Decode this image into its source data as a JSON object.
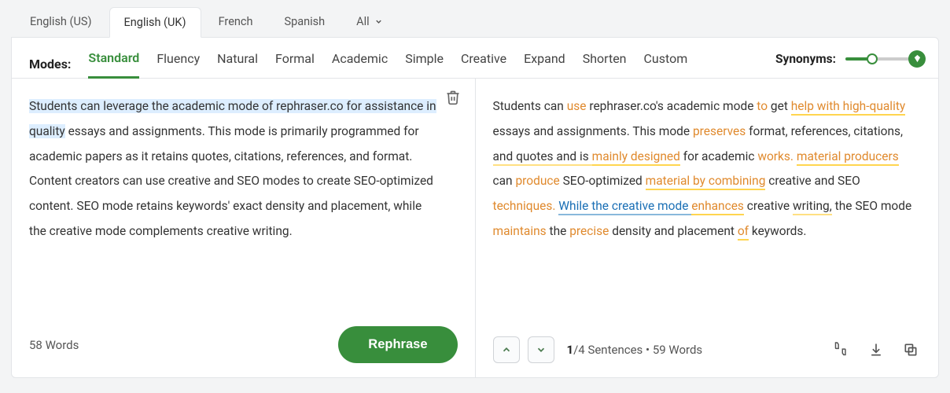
{
  "langs": {
    "en_us": "English (US)",
    "en_uk": "English (UK)",
    "fr": "French",
    "es": "Spanish",
    "all": "All"
  },
  "modes": {
    "label": "Modes:",
    "standard": "Standard",
    "fluency": "Fluency",
    "natural": "Natural",
    "formal": "Formal",
    "academic": "Academic",
    "simple": "Simple",
    "creative": "Creative",
    "expand": "Expand",
    "shorten": "Shorten",
    "custom": "Custom"
  },
  "synonyms_label": "Synonyms:",
  "input": {
    "seg1": "Students can leverage the academic mode of rephraser.co for assistance in quality",
    "seg2": " essays and assignments. This mode is primarily programmed for academic papers as it retains quotes, citations, references, and format.",
    "para2": "Content creators can use creative and SEO modes to create SEO-optimized content. SEO mode retains keywords' exact density and placement, while the creative mode complements creative writing.",
    "word_count": "58 Words",
    "button": "Rephrase"
  },
  "output": {
    "s1": "Students can ",
    "s2": "use",
    "s3": " rephraser.co's academic mode ",
    "s4": "to",
    "s5": " get ",
    "s6": "help with high-quality",
    "s7": " essays and assignments. This mode ",
    "s8": "preserves",
    "s9": " format, references, citations, ",
    "s10": "and quotes and is ",
    "s11": "mainly designed",
    "s12": " for academic ",
    "s13": "works.",
    "s14": "material producers",
    "s15": " can ",
    "s16": "produce",
    "s17": " SEO-optimized ",
    "s18": "material by combining",
    "s19": " creative and SEO ",
    "s20": "techniques.",
    "s21": " ",
    "s22": "While the creative mode ",
    "s23": "enhances",
    "s24": " creative ",
    "s25": "writing,",
    "s26": " the SEO mode ",
    "s27": "maintains",
    "s28": " the ",
    "s29": "precise",
    "s30": " density and placement ",
    "s31": "of",
    "s32": " keywords.",
    "sent_current": "1",
    "sent_total": "/4 Sentences",
    "sep": " • ",
    "word_count": "59 Words"
  }
}
